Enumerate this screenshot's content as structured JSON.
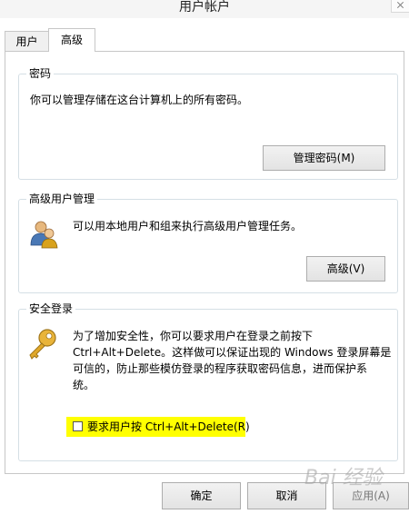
{
  "window": {
    "title": "用户帐户"
  },
  "tabs": [
    {
      "label": "用户"
    },
    {
      "label": "高级"
    }
  ],
  "passwords": {
    "title": "密码",
    "description": "你可以管理存储在这台计算机上的所有密码。",
    "button": "管理密码(M)"
  },
  "advanced_user_mgmt": {
    "title": "高级用户管理",
    "description": "可以用本地用户和组来执行高级用户管理任务。",
    "button": "高级(V)"
  },
  "secure_logon": {
    "title": "安全登录",
    "lines": [
      "为了增加安全性，你可以要求用户在登录之前按下",
      "Ctrl+Alt+Delete。这样做可以保证出现的 Windows 登录屏幕是",
      "可信的，防止那些模仿登录的程序获取密码信息，进而保护系",
      "统。"
    ],
    "checkbox_label": "要求用户按 Ctrl+Alt+Delete(R)",
    "checkbox_checked": false,
    "highlight_color": "#ffff00"
  },
  "footer": {
    "ok": "确定",
    "cancel": "取消",
    "apply": "应用(A)"
  },
  "watermark": "Bai 经验"
}
